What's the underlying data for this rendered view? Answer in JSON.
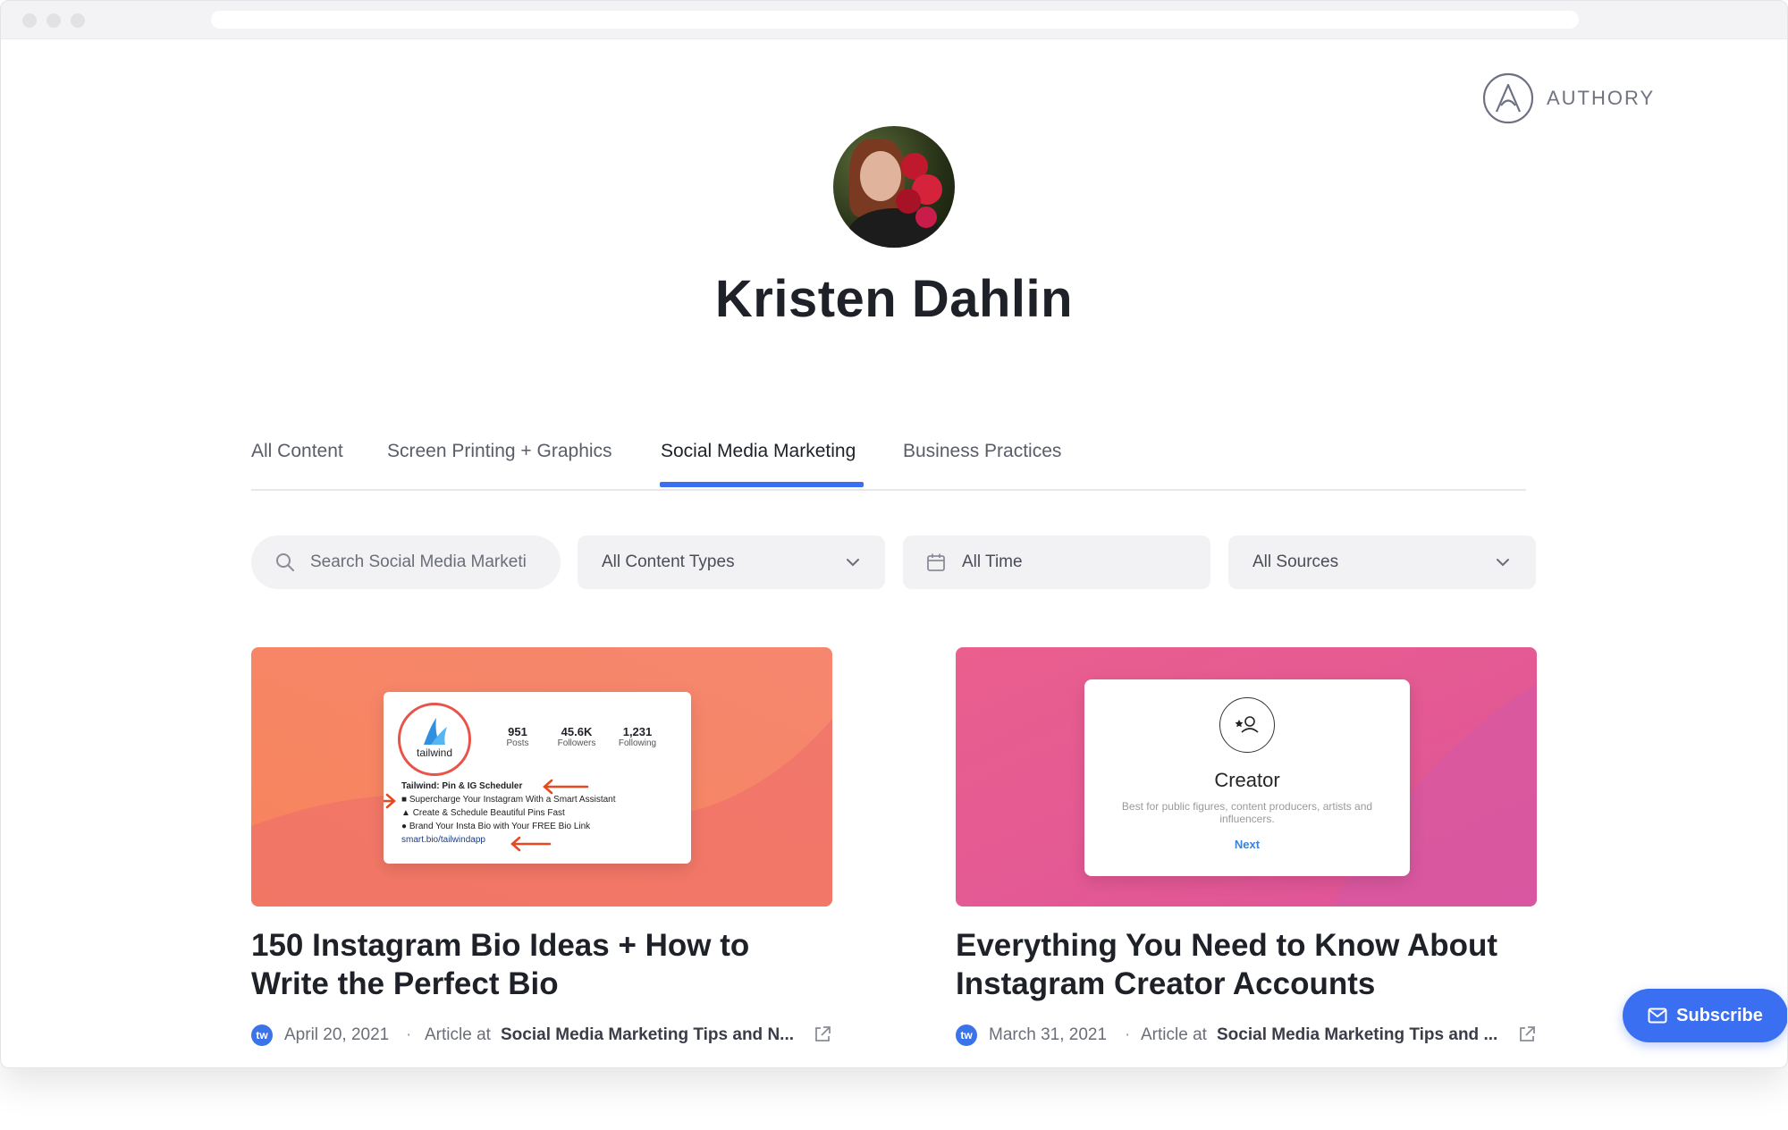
{
  "brand": {
    "name": "AUTHORY"
  },
  "profile": {
    "name": "Kristen Dahlin"
  },
  "tabs": [
    {
      "label": "All Content"
    },
    {
      "label": "Screen Printing + Graphics"
    },
    {
      "label": "Social Media Marketing",
      "active": true
    },
    {
      "label": "Business Practices"
    }
  ],
  "filters": {
    "search_placeholder": "Search Social Media Marketi",
    "content_types": "All Content Types",
    "time": "All Time",
    "sources": "All Sources"
  },
  "cards": [
    {
      "title": "150 Instagram Bio Ideas + How to Write the Perfect Bio",
      "date": "April 20, 2021",
      "kind": "Article at",
      "publication": "Social Media Marketing Tips and N...",
      "source_icon": "tw",
      "thumb_color": "#f6866a",
      "thumb": {
        "logo_text": "tailwind",
        "stats": [
          {
            "value": "951",
            "label": "Posts"
          },
          {
            "value": "45.6K",
            "label": "Followers"
          },
          {
            "value": "1,231",
            "label": "Following"
          }
        ],
        "bio_name": "Tailwind: Pin & IG Scheduler",
        "bio_lines": [
          "Supercharge Your Instagram With a Smart Assistant",
          "Create & Schedule Beautiful Pins Fast",
          "Brand Your Insta Bio with Your FREE Bio Link"
        ],
        "bio_link": "smart.bio/tailwindapp"
      }
    },
    {
      "title": "Everything You Need to Know About Instagram Creator Accounts",
      "date": "March 31, 2021",
      "kind": "Article at",
      "publication": "Social Media Marketing Tips and ...",
      "source_icon": "tw",
      "thumb_color": "#e65f96",
      "thumb": {
        "heading": "Creator",
        "description": "Best for public figures, content producers, artists and influencers.",
        "next": "Next"
      }
    }
  ],
  "subscribe": {
    "label": "Subscribe"
  },
  "colors": {
    "accent": "#3b6ff2",
    "text": "#1f2129",
    "muted": "#6b6e78"
  }
}
